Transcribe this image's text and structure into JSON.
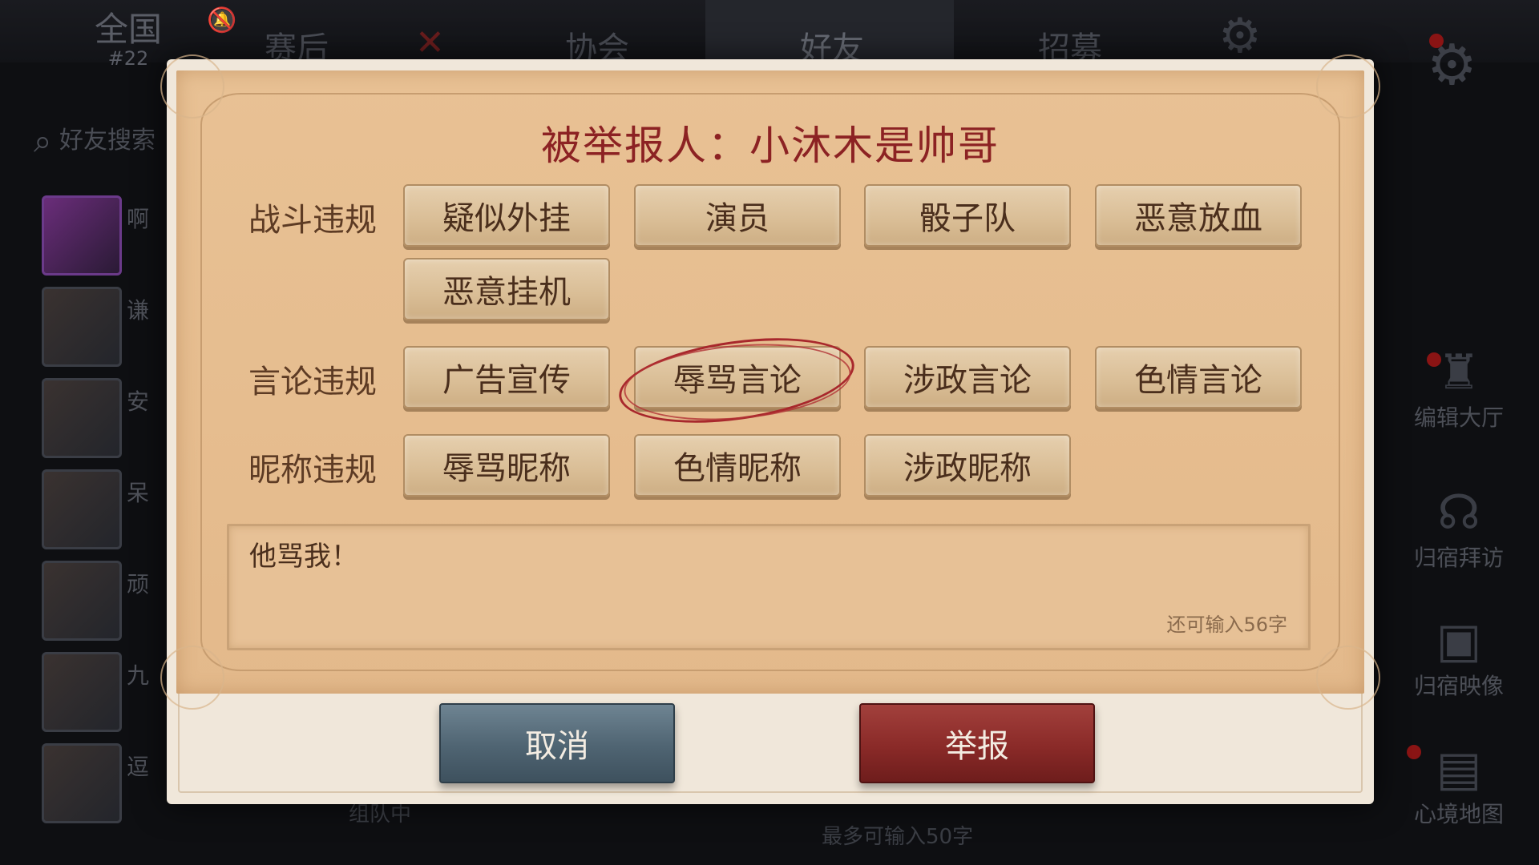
{
  "background": {
    "rank": {
      "label": "全国",
      "number": "#22"
    },
    "tabs": [
      "赛后",
      "协会",
      "好友",
      "招募"
    ],
    "active_tab": "好友",
    "search_placeholder": "好友搜索",
    "friends": [
      {
        "name": "啊"
      },
      {
        "name": "谦"
      },
      {
        "name": "安"
      },
      {
        "name": "呆"
      },
      {
        "name": "顽"
      },
      {
        "name": "九"
      },
      {
        "name": "逗"
      }
    ],
    "right_menu": [
      "编辑大厅",
      "归宿拜访",
      "归宿映像",
      "心境地图"
    ],
    "bottom_hint": "最多可输入50字",
    "bottom_status": "组队中"
  },
  "dialog": {
    "title": "被举报人：小沐木是帅哥",
    "categories": [
      {
        "label": "战斗违规",
        "options": [
          "疑似外挂",
          "演员",
          "骰子队",
          "恶意放血",
          "恶意挂机"
        ]
      },
      {
        "label": "言论违规",
        "options": [
          "广告宣传",
          "辱骂言论",
          "涉政言论",
          "色情言论"
        ]
      },
      {
        "label": "昵称违规",
        "options": [
          "辱骂昵称",
          "色情昵称",
          "涉政昵称"
        ]
      }
    ],
    "selected_option": "辱骂言论",
    "reason_text": "他骂我！",
    "remaining_chars": "还可输入56字",
    "cancel_label": "取消",
    "report_label": "举报"
  },
  "colors": {
    "title": "#8c2223",
    "cancel_button": "#4f6472",
    "report_button": "#8a2a28",
    "selection_circle": "#a8282c"
  }
}
